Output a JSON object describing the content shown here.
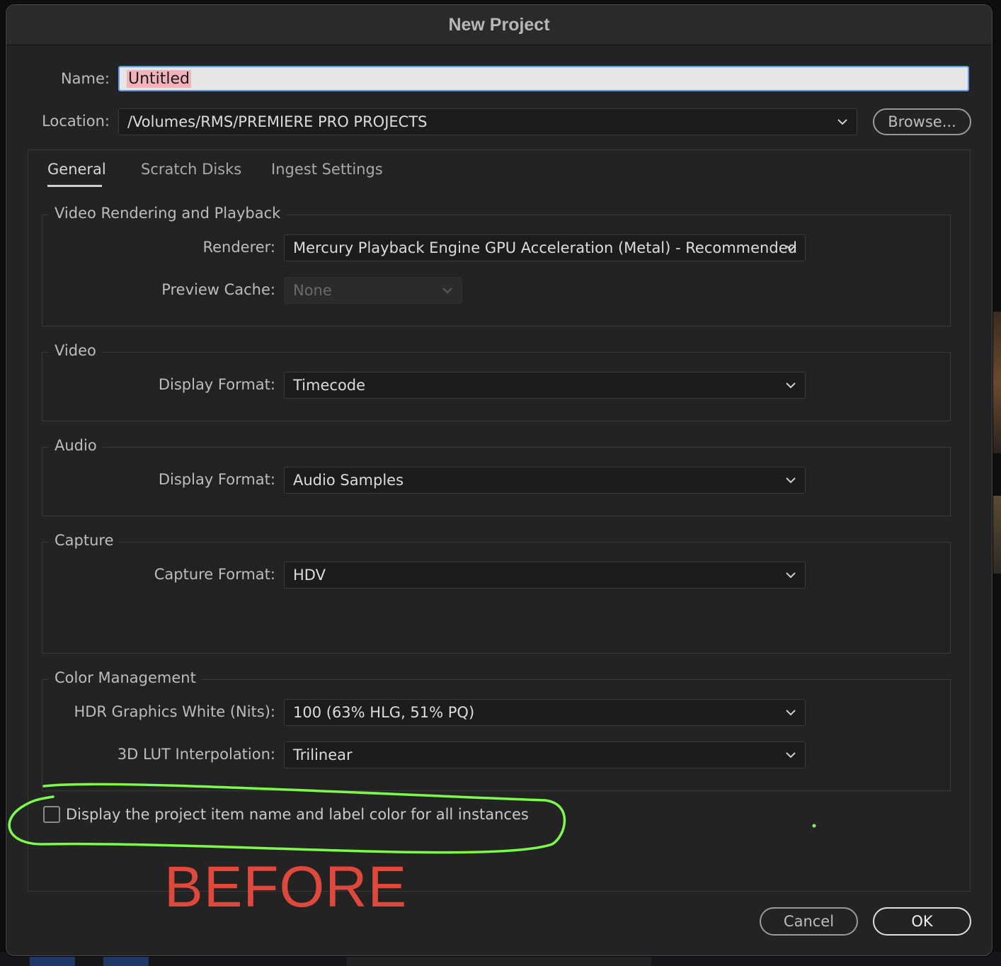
{
  "dialog": {
    "title": "New Project",
    "name_label": "Name:",
    "name_value": "Untitled",
    "location_label": "Location:",
    "location_value": "/Volumes/RMS/PREMIERE PRO PROJECTS",
    "browse_label": "Browse...",
    "tabs": [
      {
        "label": "General",
        "active": true
      },
      {
        "label": "Scratch Disks",
        "active": false
      },
      {
        "label": "Ingest Settings",
        "active": false
      }
    ],
    "video_rendering": {
      "title": "Video Rendering and Playback",
      "renderer_label": "Renderer:",
      "renderer_value": "Mercury Playback Engine GPU Acceleration (Metal) - Recommended",
      "preview_cache_label": "Preview Cache:",
      "preview_cache_value": "None"
    },
    "video": {
      "title": "Video",
      "display_format_label": "Display Format:",
      "display_format_value": "Timecode"
    },
    "audio": {
      "title": "Audio",
      "display_format_label": "Display Format:",
      "display_format_value": "Audio Samples"
    },
    "capture": {
      "title": "Capture",
      "capture_format_label": "Capture Format:",
      "capture_format_value": "HDV"
    },
    "color_management": {
      "title": "Color Management",
      "hdr_label": "HDR Graphics White (Nits):",
      "hdr_value": "100 (63% HLG, 51% PQ)",
      "lut_label": "3D LUT Interpolation:",
      "lut_value": "Trilinear"
    },
    "checkbox_label": "Display the project item name and label color for all instances",
    "checkbox_checked": false,
    "cancel_label": "Cancel",
    "ok_label": "OK"
  },
  "annotation": {
    "text": "BEFORE",
    "text_color": "#e0483c",
    "highlight_color": "#7CFC4A"
  }
}
